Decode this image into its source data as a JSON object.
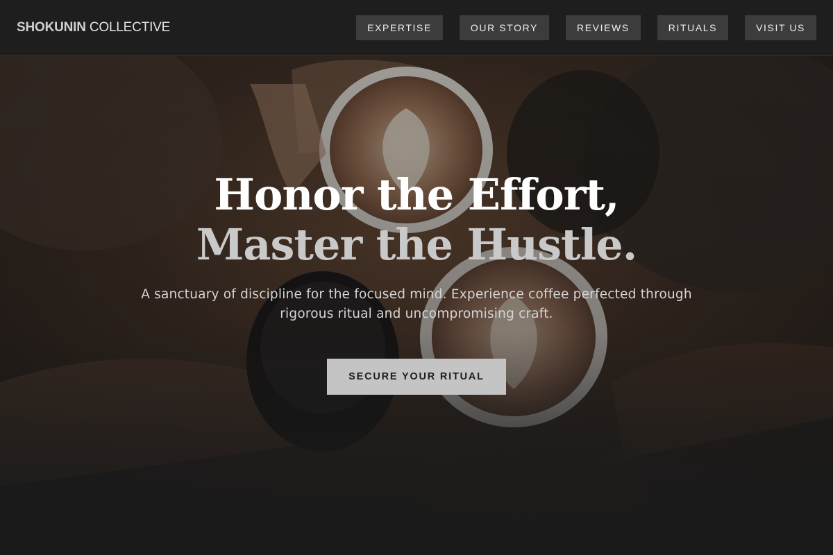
{
  "header": {
    "logo_bold": "SHOKUNIN",
    "logo_light": "COLLECTIVE",
    "nav": [
      {
        "label": "EXPERTISE"
      },
      {
        "label": "OUR STORY"
      },
      {
        "label": "REVIEWS"
      },
      {
        "label": "RITUALS"
      },
      {
        "label": "VISIT US"
      }
    ]
  },
  "hero": {
    "headline_line1": "Honor the Effort,",
    "headline_line2": "Master the Hustle.",
    "subtitle": "A sanctuary of discipline for the focused mind. Experience coffee perfected through rigorous ritual and uncompromising craft.",
    "cta_label": "SECURE YOUR RITUAL",
    "background_image": "coffee-cups-toast-photo"
  },
  "colors": {
    "header_bg": "#1e1e1e",
    "nav_button_bg": "#3c3c3c",
    "cta_bg": "#c4c4c4",
    "headline_primary": "#ffffff",
    "headline_secondary": "#c9c9c9"
  }
}
